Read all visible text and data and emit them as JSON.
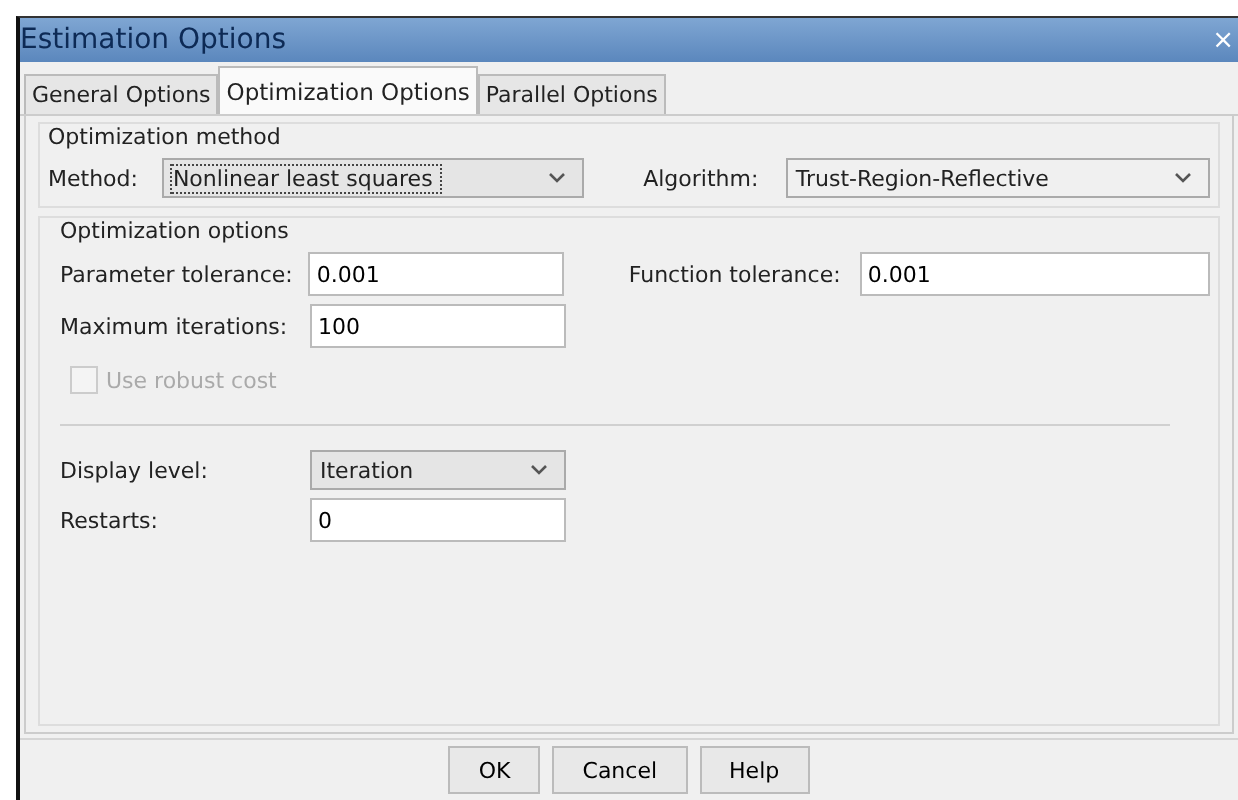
{
  "window": {
    "title": "Estimation Options",
    "close": "×"
  },
  "tabs": [
    {
      "label": "General Options",
      "selected": false
    },
    {
      "label": "Optimization Options",
      "selected": true
    },
    {
      "label": "Parallel Options",
      "selected": false
    }
  ],
  "method_group": {
    "title": "Optimization method",
    "method": {
      "label": "Method:",
      "value": "Nonlinear least squares"
    },
    "algorithm": {
      "label": "Algorithm:",
      "value": "Trust-Region-Reflective"
    }
  },
  "options_group": {
    "title": "Optimization options",
    "parameter_tolerance": {
      "label": "Parameter tolerance:",
      "value": "0.001"
    },
    "function_tolerance": {
      "label": "Function tolerance:",
      "value": "0.001"
    },
    "maximum_iterations": {
      "label": "Maximum iterations:",
      "value": "100"
    },
    "robust_cost": {
      "label": "Use robust cost",
      "checked": false,
      "disabled": true
    },
    "display_level": {
      "label": "Display level:",
      "value": "Iteration"
    },
    "restarts": {
      "label": "Restarts:",
      "value": "0"
    }
  },
  "buttons": [
    "OK",
    "Cancel",
    "Help"
  ]
}
